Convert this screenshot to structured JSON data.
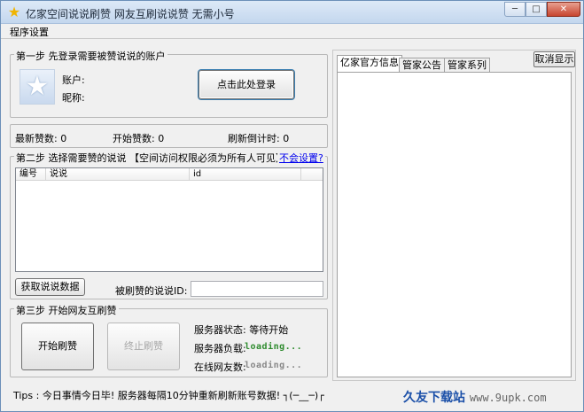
{
  "window": {
    "title": "亿家空间说说刷赞 网友互刷说说赞 无需小号",
    "min_label": "─",
    "max_label": "□",
    "close_label": "✕"
  },
  "menu": {
    "item": "程序设置"
  },
  "login": {
    "legend": "第一步 先登录需要被赞说说的账户",
    "account_label": "账户:",
    "nickname_label": "昵称:",
    "login_button": "点击此处登录"
  },
  "stats": {
    "latest_likes": "最新赞数: 0",
    "start_likes": "开始赞数: 0",
    "countdown": "刷新倒计时: 0"
  },
  "list": {
    "legend": "第二步 选择需要赞的说说 【空间访问权限必须为所有人可见】",
    "help_link": "不会设置?",
    "columns": [
      "编号",
      "说说",
      "id"
    ],
    "fetch_button": "获取说说数据",
    "id_label": "被刷赞的说说ID:"
  },
  "start": {
    "legend": "第三步 开始网友互刷赞",
    "start_button": "开始刷赞",
    "stop_button": "终止刷赞",
    "server_status": "服务器状态: 等待开始",
    "server_load_label": "服务器负载:",
    "server_load_value": "loading...",
    "online_label": "在线网友数:",
    "online_value": "loading..."
  },
  "right": {
    "tabs": [
      "亿家官方信息",
      "管家公告",
      "管家系列"
    ],
    "cancel_button": "取消显示"
  },
  "tips": "Tips : 今日事情今日毕! 服务器每隔10分钟重新刷新账号数据! ┐(─__─)┌",
  "watermark": {
    "text": "久友下载站",
    "url": "www.9upk.com"
  },
  "colors": {
    "accent_blue": "#3c7fb1",
    "loading_green": "#2e8b2e",
    "link_blue": "#0000ee"
  }
}
